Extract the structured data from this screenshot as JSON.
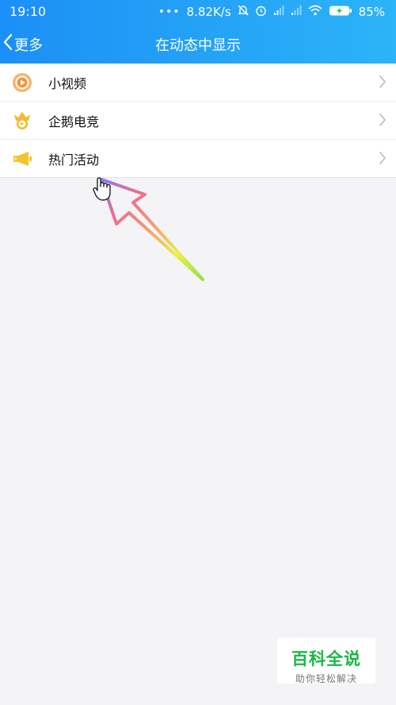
{
  "status_bar": {
    "time": "19:10",
    "dots": "•••",
    "network_speed": "8.82K/s",
    "battery": "85%",
    "icons": [
      "mute-bell-icon",
      "alarm-icon",
      "signal-icon",
      "signal-icon",
      "wifi-icon",
      "battery-charging-icon"
    ]
  },
  "nav": {
    "back_label": "更多",
    "title": "在动态中显示"
  },
  "list": {
    "items": [
      {
        "label": "小视频",
        "icon": "video-play-icon",
        "icon_color": "#f3953a"
      },
      {
        "label": "企鹅电竞",
        "icon": "esports-crown-icon",
        "icon_color": "#f5b92e"
      },
      {
        "label": "热门活动",
        "icon": "megaphone-icon",
        "icon_color": "#f4c430"
      }
    ]
  },
  "watermark": {
    "title": "百科全说",
    "subtitle": "助你轻松解决"
  },
  "colors": {
    "header_start": "#1b8ff6",
    "header_end": "#2cb4f7",
    "background": "#f4f4f6",
    "watermark_green": "#19b845"
  }
}
